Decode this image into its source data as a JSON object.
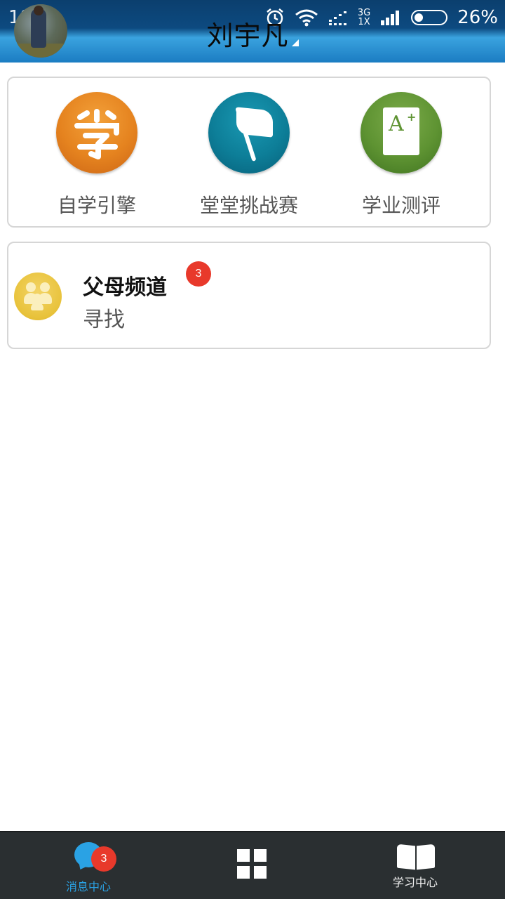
{
  "status_bar": {
    "time": "18:51",
    "network_top": "3G",
    "network_bottom": "1X",
    "battery": "26%"
  },
  "header": {
    "title": "刘宇凡",
    "accent_color": "#1b7cc2"
  },
  "apps": [
    {
      "label": "自学引擎",
      "icon": "self-study-icon",
      "color": "#e5831f"
    },
    {
      "label": "堂堂挑战赛",
      "icon": "flag-icon",
      "color": "#0d7e98"
    },
    {
      "label": "学业测评",
      "icon": "grade-document-icon",
      "color": "#5e9332"
    }
  ],
  "parent_channel": {
    "title": "父母频道",
    "subtitle": "寻找",
    "badge": "3",
    "icon": "family-icon"
  },
  "bottom_nav": {
    "messages": {
      "label": "消息中心",
      "badge": "3",
      "icon": "chat-bubble-icon",
      "active": true,
      "color": "#2aa2e4"
    },
    "apps": {
      "icon": "grid-icon"
    },
    "study": {
      "label": "学习中心",
      "icon": "book-icon"
    }
  }
}
